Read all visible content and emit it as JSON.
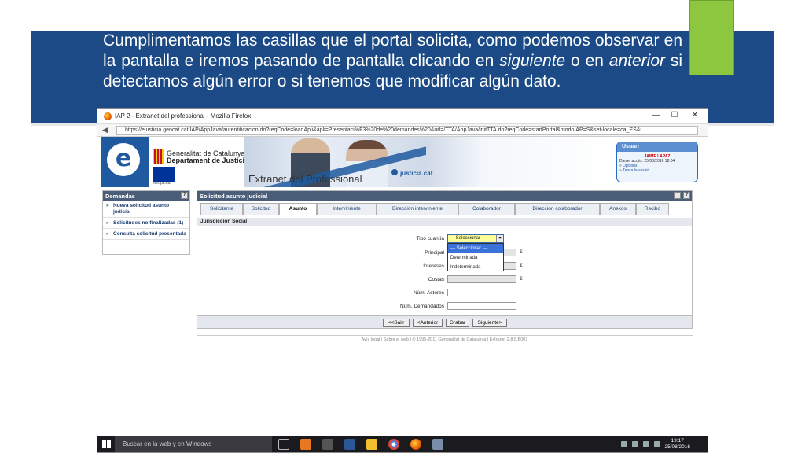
{
  "slide": {
    "text_part1": "Cumplimentamos las casillas que el portal solicita, como podemos observar en la pantalla e iremos pasando de pantalla clicando en ",
    "word_next": "siguiente",
    "text_part2": " o en ",
    "word_prev": "anterior",
    "text_part3": " si detectamos algún error o si tenemos que modificar algún dato."
  },
  "browser": {
    "title": "IAP 2 - Extranet del professional - Mozilla Firefox",
    "url": "https://ejusticia.gencat.cat/IAP/AppJava/autentificacion.do?reqCode=loadApli&apli=Presentaci%F3%20de%20demandes%20&url=/TTA/AppJava/initTTA.do?reqCode=startPortal&modoIAP=S&set-locale=ca_ES&i",
    "min_icon": "—",
    "max_icon": "☐",
    "close_icon": "✕"
  },
  "header": {
    "logo_letter": "e",
    "gencat_line1": "Generalitat de Catalunya",
    "gencat_line2": "Departament de Justícia",
    "eu_label": "europa.eu",
    "banner_title": "Extranet del Professional",
    "justicia_label": "justicia.cat"
  },
  "user": {
    "header": "Usuari",
    "name": "JAIME LAPAZ",
    "last_access": "Darrer accés: 25/08/2016 18:04",
    "options": "» Opcions",
    "logout": "» Tanca la sessió"
  },
  "sidebar": {
    "title": "Demandas",
    "help": "?",
    "items": [
      {
        "label": "Nueva solicitud asunto judicial"
      },
      {
        "label": "Solicitudes no finalizadas (1)"
      },
      {
        "label": "Consulta solicitud presentada"
      }
    ]
  },
  "main": {
    "title": "Solicitud asunto judicial",
    "help": "?",
    "tabs": [
      {
        "label": "Solicitante"
      },
      {
        "label": "Solicitud"
      },
      {
        "label": "Asunto"
      },
      {
        "label": "Interviniente"
      },
      {
        "label": "Dirección interviniente"
      },
      {
        "label": "Colaborador"
      },
      {
        "label": "Dirección colaborador"
      },
      {
        "label": "Anexos"
      },
      {
        "label": "Recibo"
      }
    ],
    "active_tab": "Asunto",
    "section": "Jurisdicción Social",
    "fields": {
      "tipo_cuantia_label": "Tipo cuantía",
      "tipo_cuantia_value": "--- Seleccionar ---",
      "principal_label": "Principal",
      "intereses_label": "Intereses",
      "costas_label": "Costas",
      "num_actores_label": "Núm. Actores",
      "num_demandados_label": "Núm. Demandados",
      "currency": "€"
    },
    "dropdown_options": [
      "--- Seleccionar ---",
      "Determinada",
      "Indeterminada"
    ],
    "buttons": {
      "salir": "<<Salir",
      "anterior": "<Anterior",
      "grabar": "Grabar",
      "siguiente": "Siguiente>"
    },
    "footer": "Avís legal  |  Sobre el web  |  © 1995-2011 Generalitat de Catalunya  |  Extranet 2.8.5.B001"
  },
  "taskbar": {
    "search_placeholder": "Buscar en la web y en Windows",
    "time": "19:17",
    "date": "25/08/2016"
  },
  "colors": {
    "slide_band": "#1b4a86",
    "accent_green": "#8dc63f",
    "panel_header": "#4a5e7a",
    "select_highlight": "#3b72d9"
  }
}
